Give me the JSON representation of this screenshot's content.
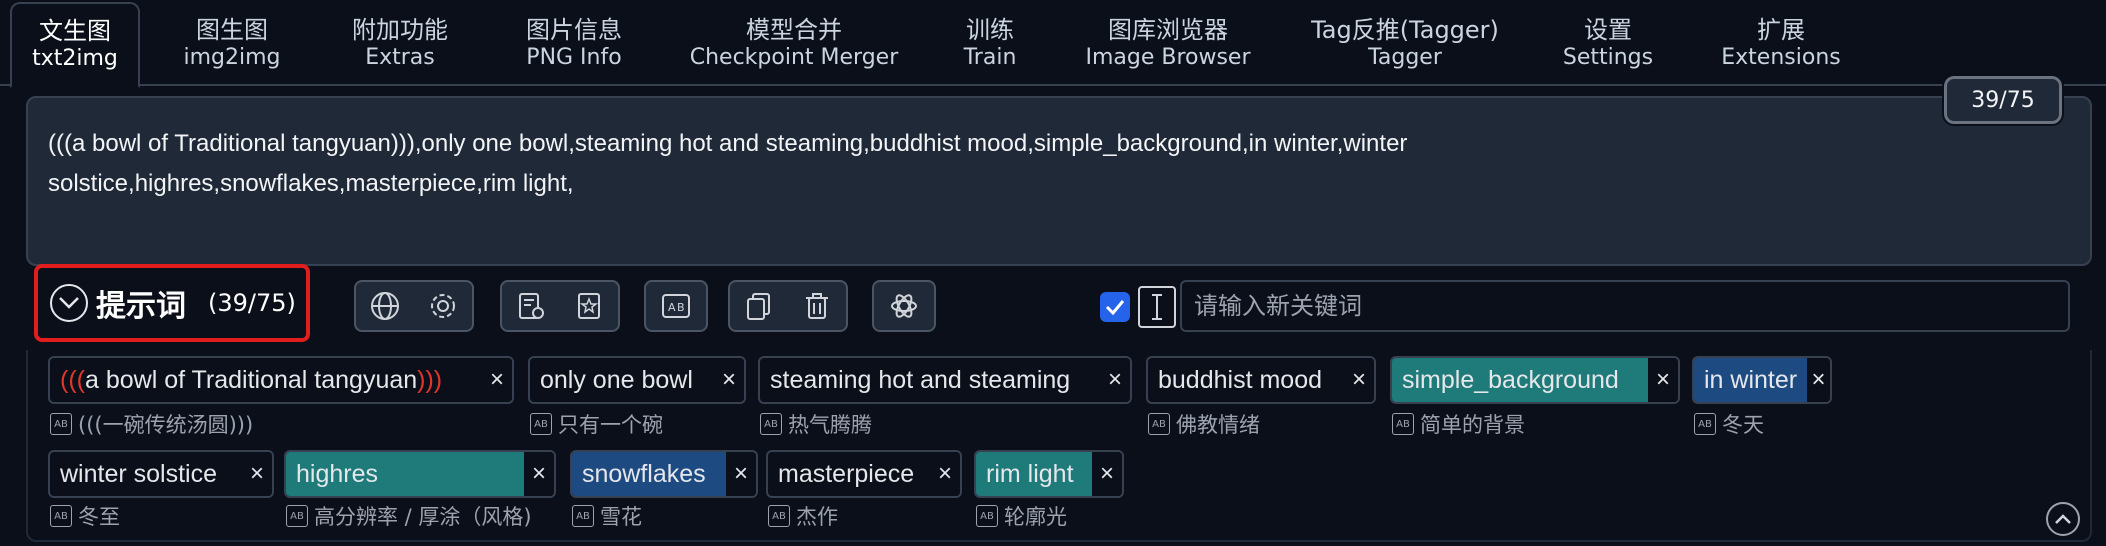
{
  "tabs": [
    {
      "zh": "文生图",
      "en": "txt2img",
      "active": true
    },
    {
      "zh": "图生图",
      "en": "img2img"
    },
    {
      "zh": "附加功能",
      "en": "Extras"
    },
    {
      "zh": "图片信息",
      "en": "PNG Info"
    },
    {
      "zh": "模型合并",
      "en": "Checkpoint Merger"
    },
    {
      "zh": "训练",
      "en": "Train"
    },
    {
      "zh": "图库浏览器",
      "en": "Image Browser"
    },
    {
      "zh": "Tag反推(Tagger)",
      "en": "Tagger"
    },
    {
      "zh": "设置",
      "en": "Settings"
    },
    {
      "zh": "扩展",
      "en": "Extensions"
    }
  ],
  "prompt": {
    "text": "(((a bowl of Traditional tangyuan))),only one bowl,steaming hot and steaming,buddhist mood,simple_background,in winter,winter\nsolstice,highres,snowflakes,masterpiece,rim light,",
    "token_count": "39/75"
  },
  "accordion": {
    "title": "提示词",
    "count": "(39/75)"
  },
  "keyword_input": {
    "placeholder": "请输入新关键词",
    "checked": true
  },
  "tags": [
    {
      "open": "(((",
      "text": "a bowl of Traditional tangyuan",
      "close": ")))",
      "trans": "(((一碗传统汤圆)))",
      "style": "plain"
    },
    {
      "text": "only one bowl",
      "trans": "只有一个碗",
      "style": "plain"
    },
    {
      "text": "steaming hot and steaming",
      "trans": "热气腾腾",
      "style": "plain"
    },
    {
      "text": "buddhist mood",
      "trans": "佛教情绪",
      "style": "plain"
    },
    {
      "text": "simple_background",
      "trans": "简单的背景",
      "style": "teal"
    },
    {
      "text": "in winter",
      "trans": "冬天",
      "style": "blue"
    },
    {
      "text": "winter solstice",
      "trans": "冬至",
      "style": "plain"
    },
    {
      "text": "highres",
      "trans": "高分辨率 / 厚涂（风格)",
      "style": "teal"
    },
    {
      "text": "snowflakes",
      "trans": "雪花",
      "style": "blue"
    },
    {
      "text": "masterpiece",
      "trans": "杰作",
      "style": "plain"
    },
    {
      "text": "rim light",
      "trans": "轮廓光",
      "style": "teal"
    }
  ],
  "colors": {
    "background": "#0b0f19",
    "teal_tag": "#1f7a7a",
    "blue_tag": "#1e4a82",
    "highlight_border": "#e11d1d",
    "checkbox": "#2563eb"
  },
  "icons": {
    "tag_close": "×",
    "translate": "AB"
  }
}
